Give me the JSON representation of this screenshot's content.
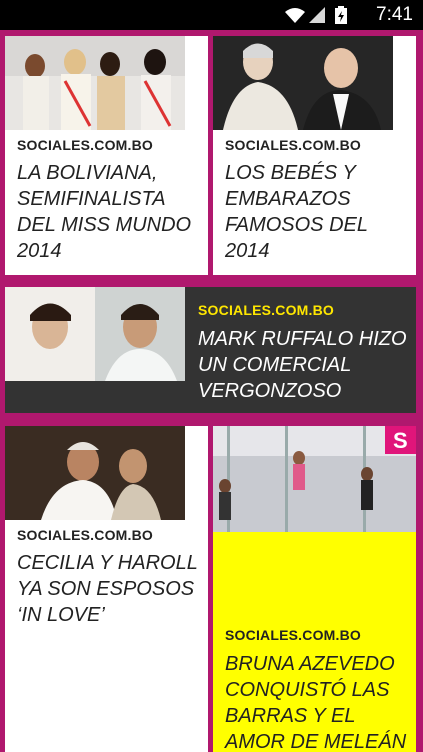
{
  "status_bar": {
    "time": "7:41",
    "battery_icon": "battery-charging-icon",
    "wifi_icon": "wifi-icon",
    "signal_icon": "cell-signal-icon"
  },
  "cards": [
    {
      "source": "SOCIALES.COM.BO",
      "title": "LA BOLIVIANA, SEMIFINALISTA DEL MISS MUNDO 2014"
    },
    {
      "source": "SOCIALES.COM.BO",
      "title": "LOS BEBÉS Y EMBARAZOS FAMOSOS DEL 2014"
    },
    {
      "source": "SOCIALES.COM.BO",
      "title": "MARK RUFFALO HIZO UN COMERCIAL VERGONZOSO"
    },
    {
      "source": "SOCIALES.COM.BO",
      "title": "CECILIA Y HAROLL YA SON ESPOSOS ‘IN LOVE’"
    },
    {
      "source": "SOCIALES.COM.BO",
      "title": "BRUNA AZEVEDO CONQUISTÓ LAS BARRAS Y EL AMOR DE MELEÁN"
    }
  ],
  "colors": {
    "background": "#b0186e",
    "dark_card": "#333333",
    "yellow_card": "#ffff00",
    "source_highlight": "#ffe700"
  }
}
